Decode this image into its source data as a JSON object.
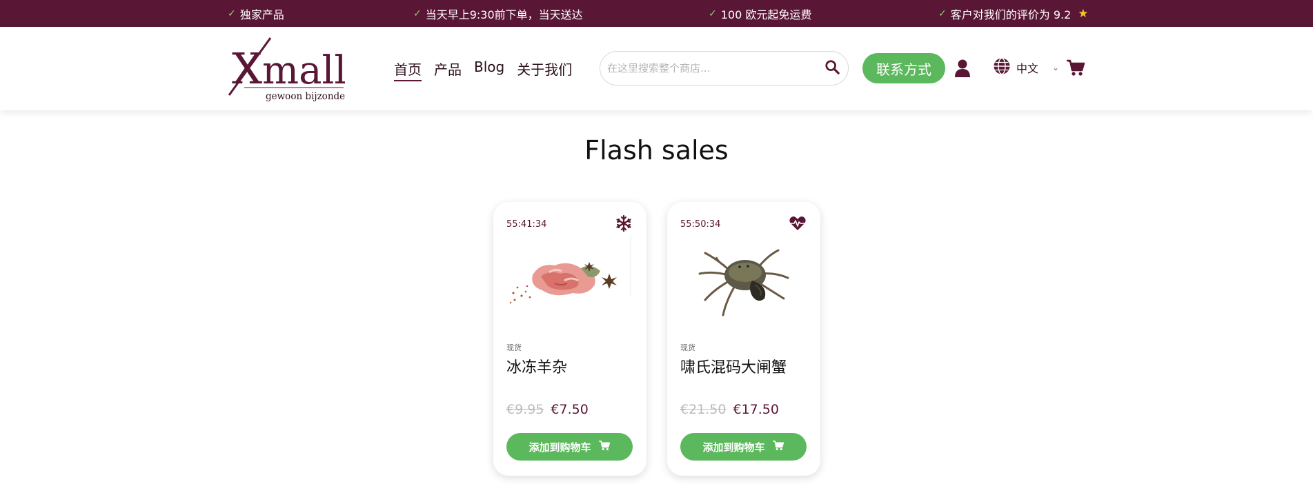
{
  "promo": {
    "item1": "独家产品",
    "item2": "当天早上9:30前下单，当天送达",
    "item3": "100 欧元起免运费",
    "item4": "客户对我们的评价为 9.2"
  },
  "brand": {
    "logo_text": "Xmall",
    "tagline": "gewoon bijzonder",
    "primary_color": "#5a1635",
    "accent_color": "#5cb85c"
  },
  "nav": {
    "home": "首页",
    "products": "产品",
    "blog": "Blog",
    "about": "关于我们"
  },
  "search": {
    "placeholder": "在这里搜索整个商店..."
  },
  "header": {
    "contact_label": "联系方式",
    "language": "中文"
  },
  "section": {
    "title": "Flash sales"
  },
  "products": [
    {
      "timer": "55:41:34",
      "badge_icon": "snowflake-icon",
      "stock": "现货",
      "name": "冰冻羊杂",
      "old_price": "€9.95",
      "new_price": "€7.50",
      "button_label": "添加到购物车"
    },
    {
      "timer": "55:50:34",
      "badge_icon": "heart-pulse-icon",
      "stock": "现货",
      "name": "啸氏混码大闸蟹",
      "old_price": "€21.50",
      "new_price": "€17.50",
      "button_label": "添加到购物车"
    }
  ]
}
